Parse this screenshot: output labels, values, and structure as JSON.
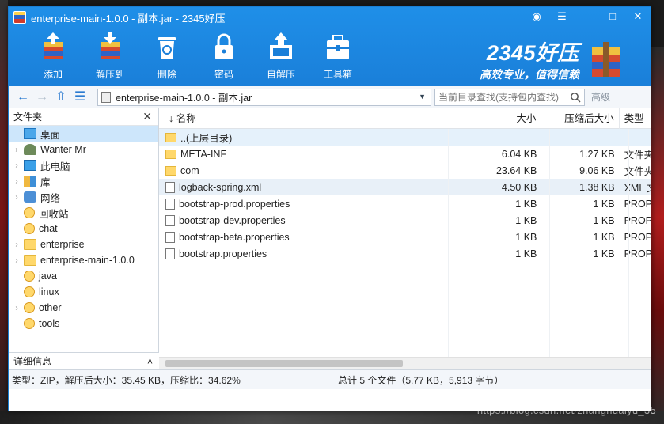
{
  "window": {
    "title": "enterprise-main-1.0.0 - 副本.jar - 2345好压"
  },
  "toolbar": {
    "items": [
      {
        "label": "添加",
        "icon": "add-archive-icon"
      },
      {
        "label": "解压到",
        "icon": "extract-to-icon"
      },
      {
        "label": "删除",
        "icon": "recycle-delete-icon"
      },
      {
        "label": "密码",
        "icon": "lock-icon"
      },
      {
        "label": "自解压",
        "icon": "self-extract-icon"
      },
      {
        "label": "工具箱",
        "icon": "toolbox-icon"
      }
    ]
  },
  "brand": {
    "name": "2345好压",
    "slogan": "高效专业，值得信赖"
  },
  "addressbar": {
    "path": "enterprise-main-1.0.0 - 副本.jar",
    "search_placeholder": "当前目录查找(支持包内查找)",
    "advanced_label": "高级"
  },
  "sidebar": {
    "header": "文件夹",
    "footer": "详细信息",
    "items": [
      {
        "label": "桌面",
        "icon": "desktop-icon",
        "caret": "",
        "selected": true
      },
      {
        "label": "Wanter Mr",
        "icon": "user-icon",
        "caret": "›"
      },
      {
        "label": "此电脑",
        "icon": "computer-icon",
        "caret": "›"
      },
      {
        "label": "库",
        "icon": "library-icon",
        "caret": "›"
      },
      {
        "label": "网络",
        "icon": "network-icon",
        "caret": "›"
      },
      {
        "label": "回收站",
        "icon": "recycle-bin-icon",
        "caret": ""
      },
      {
        "label": "chat",
        "icon": "emoji-folder-icon",
        "caret": ""
      },
      {
        "label": "enterprise",
        "icon": "folder-icon",
        "caret": "›"
      },
      {
        "label": "enterprise-main-1.0.0",
        "icon": "folder-icon",
        "caret": "›"
      },
      {
        "label": "java",
        "icon": "emoji-folder-icon",
        "caret": ""
      },
      {
        "label": "linux",
        "icon": "emoji-folder-icon",
        "caret": ""
      },
      {
        "label": "other",
        "icon": "emoji-folder-icon",
        "caret": "›"
      },
      {
        "label": "tools",
        "icon": "emoji-folder-icon",
        "caret": ""
      }
    ]
  },
  "filelist": {
    "columns": {
      "name": "名称",
      "size": "大小",
      "compressed": "压缩后大小",
      "type": "类型"
    },
    "rows": [
      {
        "name": "..(上层目录)",
        "size": "",
        "compressed": "",
        "type": "",
        "kind": "folder"
      },
      {
        "name": "META-INF",
        "size": "6.04 KB",
        "compressed": "1.27 KB",
        "type": "文件夹",
        "kind": "folder"
      },
      {
        "name": "com",
        "size": "23.64 KB",
        "compressed": "9.06 KB",
        "type": "文件夹",
        "kind": "folder"
      },
      {
        "name": "logback-spring.xml",
        "size": "4.50 KB",
        "compressed": "1.38 KB",
        "type": "XML 文档",
        "kind": "file"
      },
      {
        "name": "bootstrap-prod.properties",
        "size": "1 KB",
        "compressed": "1 KB",
        "type": "PROPERTIES",
        "kind": "file"
      },
      {
        "name": "bootstrap-dev.properties",
        "size": "1 KB",
        "compressed": "1 KB",
        "type": "PROPERTIES",
        "kind": "file"
      },
      {
        "name": "bootstrap-beta.properties",
        "size": "1 KB",
        "compressed": "1 KB",
        "type": "PROPERTIES",
        "kind": "file"
      },
      {
        "name": "bootstrap.properties",
        "size": "1 KB",
        "compressed": "1 KB",
        "type": "PROPERTIES",
        "kind": "file"
      }
    ]
  },
  "status": {
    "left": "类型：ZIP，解压后大小：35.45 KB，压缩比：34.62%",
    "right": "总计 5 个文件（5.77 KB，5,913 字节）"
  },
  "watermark": "https://blog.csdn.net/zhanghuaiyu_35"
}
